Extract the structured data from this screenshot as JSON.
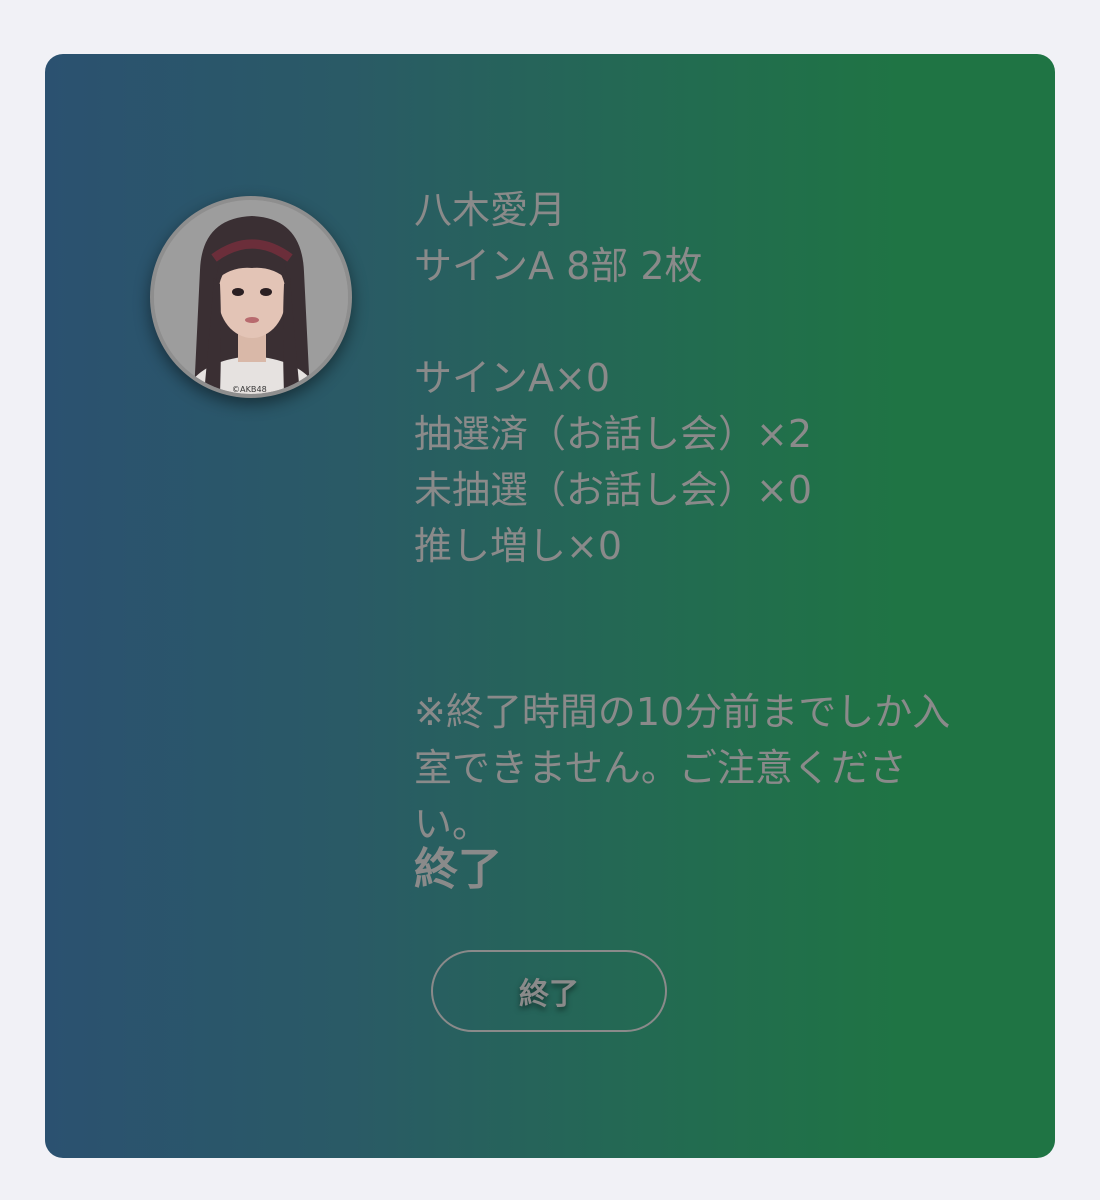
{
  "member": {
    "name": "八木愛月",
    "ticket": "サインA 8部 2枚",
    "avatar_copyright": "©AKB48"
  },
  "counts": [
    "サインA×0",
    "抽選済（お話し会）×2",
    "未抽選（お話し会）×0",
    "推し増し×0"
  ],
  "notice": "※終了時間の10分前までしか入室できません。ご注意ください。",
  "status_label": "終了",
  "button_label": "終了",
  "colors": {
    "page_bg": "#f1f1f6",
    "gradient_left": "#2b5170",
    "gradient_right": "#1f7444",
    "text": "#8a8a8a"
  }
}
